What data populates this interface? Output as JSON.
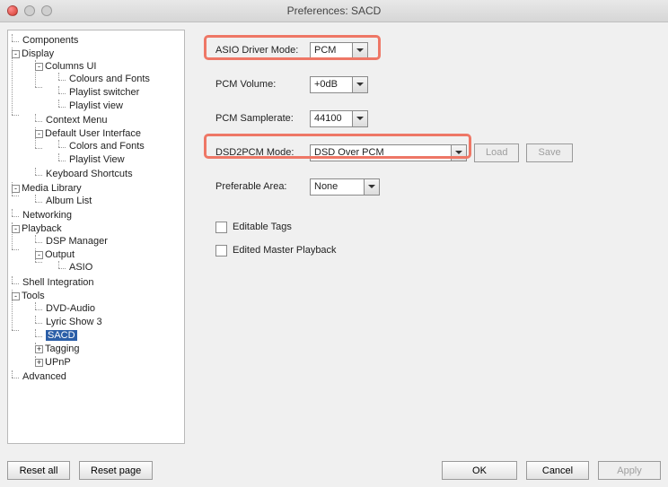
{
  "window": {
    "title": "Preferences: SACD"
  },
  "tree": {
    "components": "Components",
    "display": "Display",
    "columns_ui": "Columns UI",
    "colours_and_fonts": "Colours and Fonts",
    "playlist_switcher": "Playlist switcher",
    "playlist_view_1": "Playlist view",
    "context_menu": "Context Menu",
    "default_ui": "Default User Interface",
    "colors_and_fonts": "Colors and Fonts",
    "playlist_view_2": "Playlist View",
    "keyboard_shortcuts": "Keyboard Shortcuts",
    "media_library": "Media Library",
    "album_list": "Album List",
    "networking": "Networking",
    "playback": "Playback",
    "dsp_manager": "DSP Manager",
    "output": "Output",
    "asio": "ASIO",
    "shell_integration": "Shell Integration",
    "tools": "Tools",
    "dvd_audio": "DVD-Audio",
    "lyric_show_3": "Lyric Show 3",
    "sacd": "SACD",
    "tagging": "Tagging",
    "upnp": "UPnP",
    "advanced": "Advanced",
    "toggle_minus": "-",
    "toggle_plus": "+"
  },
  "settings": {
    "asio_mode_label": "ASIO Driver Mode:",
    "asio_mode_value": "PCM",
    "pcm_volume_label": "PCM Volume:",
    "pcm_volume_value": "+0dB",
    "pcm_samplerate_label": "PCM Samplerate:",
    "pcm_samplerate_value": "44100",
    "dsd2pcm_label": "DSD2PCM Mode:",
    "dsd2pcm_value": "DSD Over PCM",
    "load_btn": "Load",
    "save_btn": "Save",
    "pref_area_label": "Preferable Area:",
    "pref_area_value": "None",
    "editable_tags": "Editable Tags",
    "edited_master": "Edited Master Playback"
  },
  "footer": {
    "reset_all": "Reset all",
    "reset_page": "Reset page",
    "ok": "OK",
    "cancel": "Cancel",
    "apply": "Apply"
  }
}
